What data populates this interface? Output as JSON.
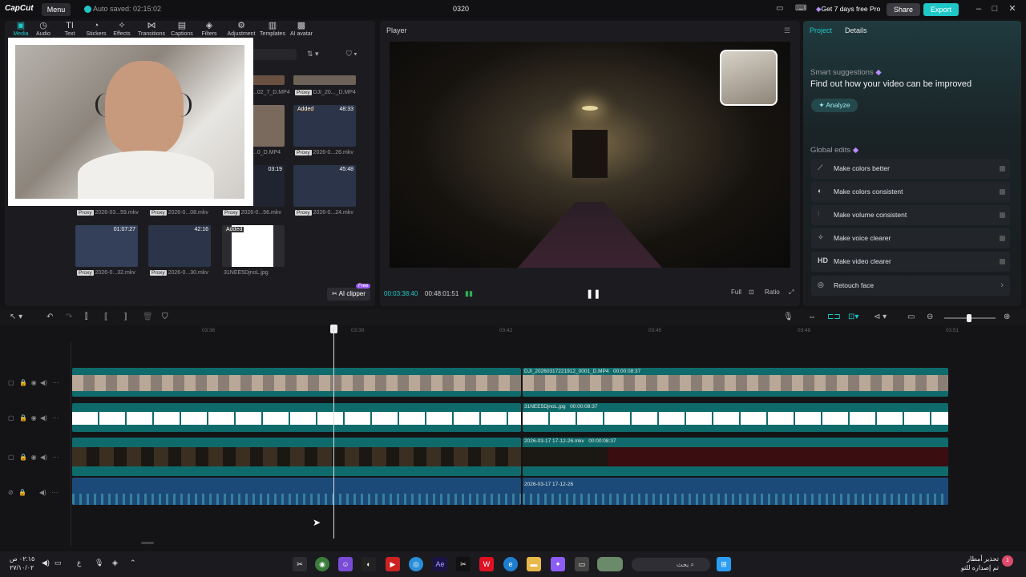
{
  "titlebar": {
    "logo": "CapCut",
    "menu": "Menu",
    "autosave": "Auto saved: 02:15:02",
    "project_title": "0320",
    "pro": "Get 7 days free Pro",
    "share": "Share",
    "export": "Export"
  },
  "toolbar": [
    {
      "label": "Media",
      "icon": "media-icon"
    },
    {
      "label": "Audio",
      "icon": "audio-icon"
    },
    {
      "label": "Text",
      "icon": "text-icon"
    },
    {
      "label": "Stickers",
      "icon": "sticker-icon"
    },
    {
      "label": "Effects",
      "icon": "effects-icon"
    },
    {
      "label": "Transitions",
      "icon": "transition-icon"
    },
    {
      "label": "Captions",
      "icon": "captions-icon"
    },
    {
      "label": "Filters",
      "icon": "filters-icon"
    },
    {
      "label": "Adjustment",
      "icon": "adjust-icon"
    },
    {
      "label": "Templates",
      "icon": "templates-icon"
    },
    {
      "label": "AI avatar",
      "icon": "avatar-icon"
    }
  ],
  "media": {
    "items": [
      {
        "name": "...02_7_D.MP4",
        "dur": "",
        "added": ""
      },
      {
        "name": "DJI_20..._D.MP4",
        "dur": "",
        "added": ""
      },
      {
        "name": "...0_D.MP4",
        "dur": "",
        "added": ""
      },
      {
        "name": "2026-0...26.mkv",
        "dur": "48:33",
        "added": "Added"
      },
      {
        "name": "2026-03...59.mkv",
        "dur": "",
        "added": ""
      },
      {
        "name": "2026-0...08.mkv",
        "dur": "",
        "added": ""
      },
      {
        "name": "2026-0...56.mkv",
        "dur": "03:19",
        "added": ""
      },
      {
        "name": "2026-0...24.mkv",
        "dur": "45:48",
        "added": ""
      },
      {
        "name": "2026-0...32.mkv",
        "dur": "01:07:27",
        "added": ""
      },
      {
        "name": "2026-0...30.mkv",
        "dur": "42:16",
        "added": ""
      },
      {
        "name": "31NEE5DjnoL.jpg",
        "dur": "",
        "added": "Added"
      }
    ],
    "proxy": "Proxy",
    "ai_clipper": "AI clipper",
    "free": "Free"
  },
  "player": {
    "title": "Player",
    "time_current": "00:03:38:40",
    "time_total": "00:48:01:51",
    "full": "Full",
    "ratio": "Ratio"
  },
  "right": {
    "tab_project": "Project",
    "tab_details": "Details",
    "smart_title": "Smart suggestions",
    "smart_sub": "Find out how your video can be improved",
    "analyze": "Analyze",
    "global_title": "Global edits",
    "items": [
      {
        "label": "Make colors better",
        "icon": "wand-icon"
      },
      {
        "label": "Make colors consistent",
        "icon": "palette-icon"
      },
      {
        "label": "Make volume consistent",
        "icon": "sliders-icon"
      },
      {
        "label": "Make voice clearer",
        "icon": "voice-icon"
      },
      {
        "label": "Make video clearer",
        "icon": "hd-icon"
      },
      {
        "label": "Retouch face",
        "icon": "face-icon"
      }
    ],
    "hd": "HD"
  },
  "timeline": {
    "ticks": [
      "03:36",
      "03:39",
      "03:42",
      "03:45",
      "03:48",
      "03:51"
    ],
    "tracks": [
      {
        "label": "DJI_20260317221912_0001_D.MP4",
        "dur": "00:00:08:37"
      },
      {
        "label": "31NEE5DjnoL.jpg",
        "dur": "00:00:08:37"
      },
      {
        "label": "2026-03-17 17-12-26.mkv",
        "dur": "00:00:08:37"
      },
      {
        "label": "2026-03-17 17-12-26",
        "dur": ""
      }
    ]
  },
  "taskbar": {
    "time": "٠٢:١٥ ص",
    "date": "٢٧/١٠/٠٢",
    "lang": "ع",
    "search": "بحث",
    "notif_title": "تحذير أمطار",
    "notif_sub": "تم إصداره للتو",
    "notif_count": "1"
  },
  "colors": {
    "accent": "#20c7c7",
    "video_track": "#0f6b6b",
    "audio_track": "#1b4a78",
    "purple": "#9b5cf6"
  }
}
